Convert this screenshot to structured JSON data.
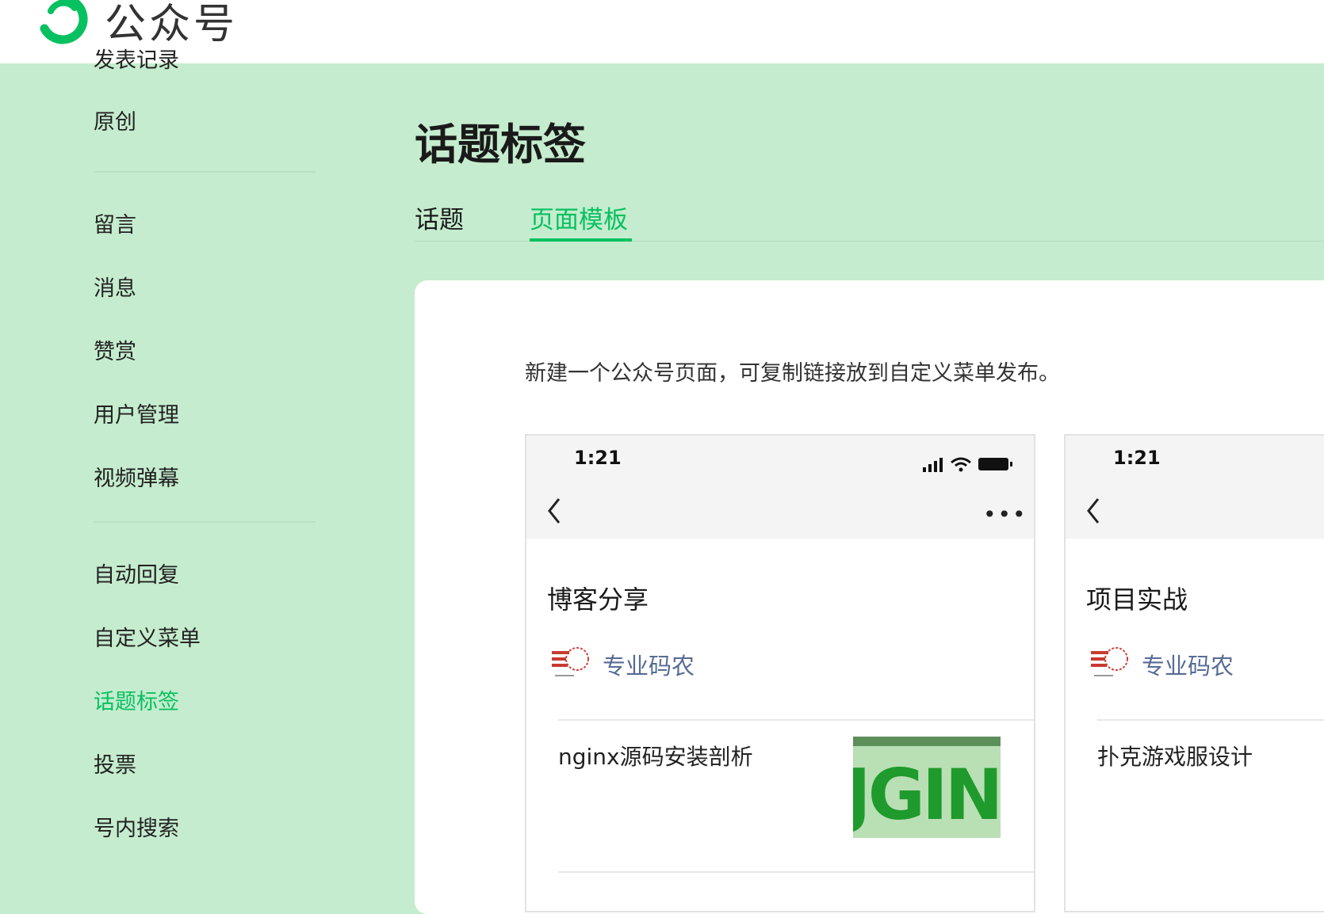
{
  "header": {
    "brand": "公众号"
  },
  "sidebar": {
    "cut_item": "发表记录",
    "items": [
      {
        "label": "原创"
      },
      {
        "label": "留言"
      },
      {
        "label": "消息"
      },
      {
        "label": "赞赏"
      },
      {
        "label": "用户管理"
      },
      {
        "label": "视频弹幕"
      },
      {
        "label": "自动回复"
      },
      {
        "label": "自定义菜单"
      },
      {
        "label": "话题标签",
        "active": true
      },
      {
        "label": "投票"
      },
      {
        "label": "号内搜索"
      }
    ]
  },
  "main": {
    "title": "话题标签",
    "tabs": [
      {
        "label": "话题"
      },
      {
        "label": "页面模板",
        "active": true
      }
    ],
    "description": "新建一个公众号页面，可复制链接放到自定义菜单发布。",
    "templates": [
      {
        "time": "1:21",
        "page_title": "博客分享",
        "account": "专业码农",
        "article_title": "nginx源码安装剖析",
        "thumbnail_text": "JGIN"
      },
      {
        "time": "1:21",
        "page_title": "项目实战",
        "account": "专业码农",
        "article_title": "扑克游戏服设计"
      }
    ]
  },
  "colors": {
    "accent": "#07c160",
    "background": "#c5ecce",
    "link": "#576b95"
  }
}
